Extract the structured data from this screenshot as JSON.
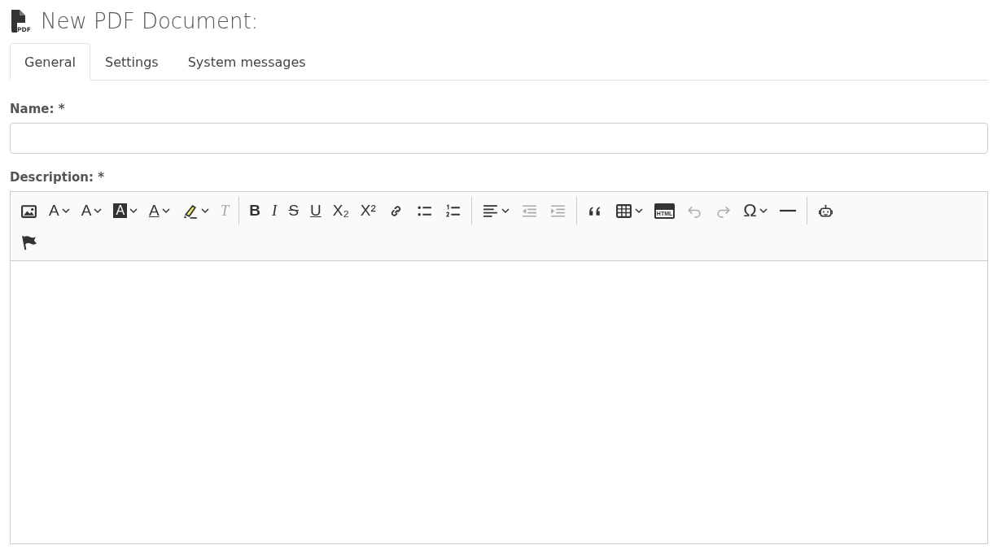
{
  "title": {
    "icon_label": "PDF",
    "text": "New PDF Document:"
  },
  "tabs": [
    {
      "label": "General",
      "selected": true
    },
    {
      "label": "Settings",
      "selected": false
    },
    {
      "label": "System messages",
      "selected": false
    }
  ],
  "fields": [
    {
      "label": "Name:",
      "required": "*"
    }
  ],
  "editor": {
    "label": "Description:",
    "required": "*",
    "toolbar_rows": [
      [
        {
          "kind": "image",
          "dropdown": false,
          "disabled": false
        },
        {
          "kind": "font-family",
          "glyph": "A",
          "dropdown": true,
          "disabled": false
        },
        {
          "kind": "font-size",
          "glyph": "A",
          "dropdown": true,
          "disabled": false
        },
        {
          "kind": "background",
          "glyph": "A",
          "dropdown": true,
          "disabled": false
        },
        {
          "kind": "text-color",
          "glyph": "A",
          "dropdown": true,
          "disabled": false
        },
        {
          "kind": "highlight",
          "dropdown": true,
          "disabled": false
        },
        {
          "kind": "clear",
          "glyph": "T",
          "dropdown": false,
          "disabled": true
        },
        {
          "kind": "separator"
        },
        {
          "kind": "bold",
          "glyph": "B",
          "dropdown": false,
          "disabled": false
        },
        {
          "kind": "italic",
          "glyph": "I",
          "dropdown": false,
          "disabled": false
        },
        {
          "kind": "strike",
          "glyph": "S",
          "dropdown": false,
          "disabled": false
        },
        {
          "kind": "underline",
          "glyph": "U",
          "dropdown": false,
          "disabled": false
        },
        {
          "kind": "subscript",
          "glyph": "X₂",
          "dropdown": false,
          "disabled": false
        },
        {
          "kind": "superscript",
          "glyph": "X²",
          "dropdown": false,
          "disabled": false
        },
        {
          "kind": "link",
          "dropdown": false,
          "disabled": false
        },
        {
          "kind": "bullets",
          "dropdown": false,
          "disabled": false
        },
        {
          "kind": "numbers",
          "dropdown": false,
          "disabled": false
        },
        {
          "kind": "separator"
        },
        {
          "kind": "align",
          "dropdown": true,
          "disabled": false
        },
        {
          "kind": "outdent",
          "dropdown": false,
          "disabled": true
        },
        {
          "kind": "indent",
          "dropdown": false,
          "disabled": true
        },
        {
          "kind": "separator"
        },
        {
          "kind": "quote",
          "dropdown": false,
          "disabled": false
        },
        {
          "kind": "table",
          "dropdown": true,
          "disabled": false
        },
        {
          "kind": "html",
          "glyph": "HTML",
          "dropdown": false,
          "disabled": false
        },
        {
          "kind": "undo",
          "dropdown": false,
          "disabled": true
        },
        {
          "kind": "redo",
          "dropdown": false,
          "disabled": true
        },
        {
          "kind": "special",
          "glyph": "Ω",
          "dropdown": true,
          "disabled": false
        },
        {
          "kind": "rule",
          "dropdown": false,
          "disabled": false
        },
        {
          "kind": "separator"
        },
        {
          "kind": "robot",
          "dropdown": false,
          "disabled": false
        }
      ],
      [
        {
          "kind": "flag",
          "dropdown": false,
          "disabled": false
        }
      ]
    ]
  }
}
